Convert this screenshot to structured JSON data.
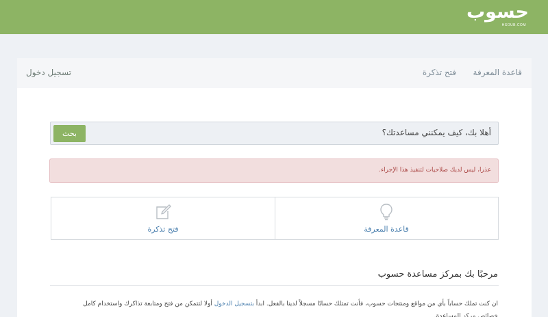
{
  "header": {
    "logo_text": "حسوب",
    "logo_sub": "HSOUB.COM",
    "brand_color": "#8db464"
  },
  "nav": {
    "knowledge_base": "قاعدة المعرفة",
    "open_ticket": "فتح تذكرة",
    "login": "تسجيل دخول"
  },
  "search": {
    "placeholder": "أهلا بك، كيف يمكنني مساعدتك؟",
    "button_label": "بحث"
  },
  "alert": {
    "text": "عذرا، ليس لديك صلاحيات لتنفيذ هذا الإجراء."
  },
  "tiles": {
    "knowledge_base": {
      "label": "قاعدة المعرفة",
      "icon": "lightbulb-icon"
    },
    "open_ticket": {
      "label": "فتح تذكرة",
      "icon": "edit-icon"
    }
  },
  "welcome": {
    "title": "مرحبًا بك بمركز مساعدة حسوب",
    "text_before": "ان كنت تملك حساباً بأي من مواقع ومنتجات حسوب، فأنت تمتلك حسابًا مسجلاً لدينا بالفعل. ابدأ ",
    "link": "بتسجيل الدخول",
    "text_after": " أولا لتتمكن من فتح ومتابعة تذاكرك واستخدام كامل خصائص مركز المساعدة."
  }
}
